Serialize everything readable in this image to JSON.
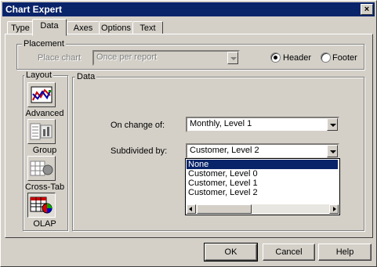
{
  "window": {
    "title": "Chart Expert",
    "close_glyph": "×"
  },
  "tabs": [
    {
      "label": "Type",
      "active": false
    },
    {
      "label": "Data",
      "active": true
    },
    {
      "label": "Axes",
      "active": false
    },
    {
      "label": "Options",
      "active": false
    },
    {
      "label": "Text",
      "active": false
    }
  ],
  "placement": {
    "group_label": "Placement",
    "place_chart_label": "Place chart",
    "place_chart_value": "Once per report",
    "header_label": "Header",
    "footer_label": "Footer",
    "selected": "Header"
  },
  "layout": {
    "group_label": "Layout",
    "buttons": [
      {
        "label": "Advanced",
        "icon": "advanced-chart-icon"
      },
      {
        "label": "Group",
        "icon": "group-chart-icon"
      },
      {
        "label": "Cross-Tab",
        "icon": "cross-tab-chart-icon"
      },
      {
        "label": "OLAP",
        "icon": "olap-chart-icon",
        "pressed": true
      }
    ]
  },
  "data": {
    "group_label": "Data",
    "on_change_of_label": "On change of:",
    "on_change_of_value": "Monthly, Level 1",
    "subdivided_by_label": "Subdivided by:",
    "subdivided_by_value": "Customer, Level 2",
    "options": [
      "None",
      "Customer, Level 0",
      "Customer, Level 1",
      "Customer, Level 2"
    ],
    "selected_option": "None"
  },
  "buttons": {
    "ok": "OK",
    "cancel": "Cancel",
    "help": "Help"
  },
  "colors": {
    "titlebar": "#0a246a",
    "face": "#d4d0c8",
    "selection": "#0a246a"
  }
}
